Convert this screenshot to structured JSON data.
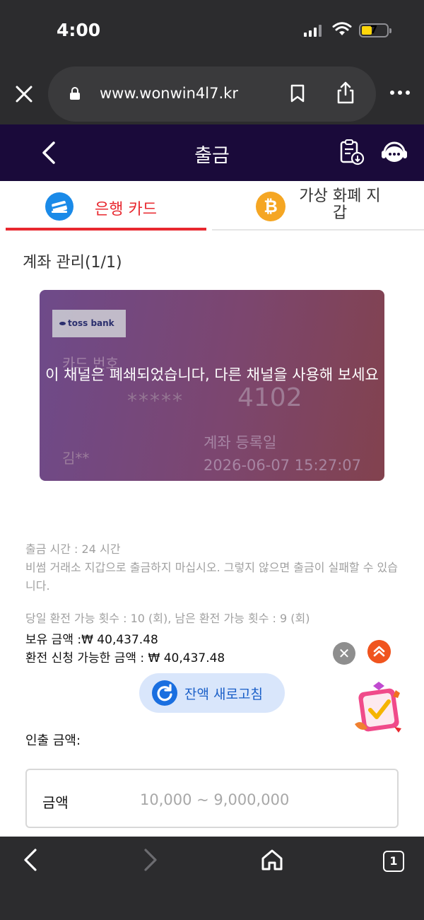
{
  "status_bar": {
    "time": "4:00",
    "battery": "7"
  },
  "browser": {
    "url": "www.wonwin4l7.kr",
    "tab_count": "1"
  },
  "header": {
    "title": "출금"
  },
  "tabs": [
    {
      "label": "은행 카드",
      "active": true
    },
    {
      "label": "가상 화폐 지갑",
      "active": false
    }
  ],
  "account": {
    "title": "계좌 관리(1/1)",
    "card": {
      "bank_name": "toss bank",
      "number_label": "카드 번호",
      "masked": "*****",
      "last4": "4102",
      "holder": "김**",
      "registered_label": "계좌 등록일",
      "registered_date": "2026-06-07 15:27:07",
      "overlay_message": "이 채널은 폐쇄되었습니다, 다른 채널을 사용해 보세요"
    }
  },
  "info": {
    "withdraw_time": "출금 시간 :  24 시간",
    "warning": "비썸 거래소 지갑으로 출금하지 마십시오. 그렇지 않으면 출금이 실패할 수 있습니다.",
    "exchange_count": "당일 환전 가능 횟수 : 10 (회), 남은 환전 가능 횟수 : 9 (회)",
    "balance": "보유 금액 :₩ 40,437.48",
    "available": "환전 신청 가능한 금액 : ₩ 40,437.48"
  },
  "refresh_button": "잔액 새로고침",
  "withdraw": {
    "amount_title": "인출 금액:",
    "field_label": "금액",
    "placeholder": "10,000 ~ 9,000,000"
  },
  "colors": {
    "header_bg": "#1a0a3a",
    "accent_red": "#e8282f",
    "refresh_blue": "#1a6fe0",
    "card_gradient_start": "#6e4a8a",
    "card_gradient_end": "#82424e"
  }
}
